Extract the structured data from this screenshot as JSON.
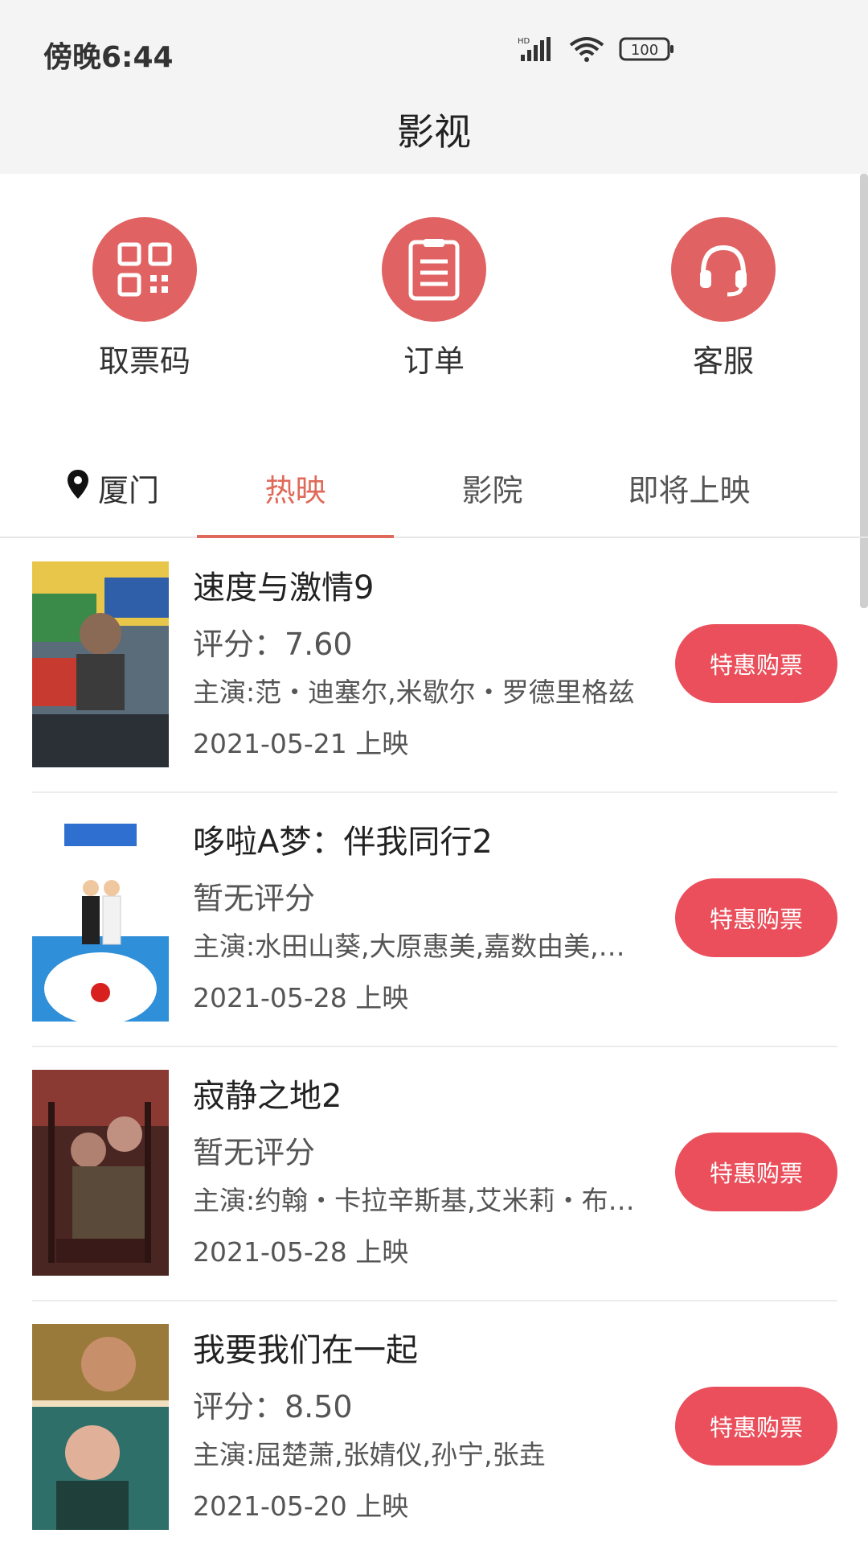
{
  "status_bar": {
    "time": "傍晚6:44",
    "network": "HD",
    "battery": "100"
  },
  "header": {
    "title": "影视"
  },
  "quick_actions": [
    {
      "label": "取票码",
      "icon": "qr-code-icon"
    },
    {
      "label": "订单",
      "icon": "order-list-icon"
    },
    {
      "label": "客服",
      "icon": "headset-icon"
    }
  ],
  "tabs": {
    "location": "厦门",
    "items": [
      "热映",
      "影院",
      "即将上映"
    ],
    "active": "热映"
  },
  "movies": [
    {
      "title": "速度与激情9",
      "rating": "评分：7.60",
      "cast": "主演:范・迪塞尔,米歇尔・罗德里格兹",
      "date": "2021-05-21 上映",
      "button": "特惠购票"
    },
    {
      "title": "哆啦A梦：伴我同行2",
      "rating": "暂无评分",
      "cast": "主演:水田山葵,大原惠美,嘉数由美,关智一",
      "date": "2021-05-28 上映",
      "button": "特惠购票"
    },
    {
      "title": "寂静之地2",
      "rating": "暂无评分",
      "cast": "主演:约翰・卡拉辛斯基,艾米莉・布朗特",
      "date": "2021-05-28 上映",
      "button": "特惠购票"
    },
    {
      "title": "我要我们在一起",
      "rating": "评分：8.50",
      "cast": "主演:屈楚萧,张婧仪,孙宁,张垚",
      "date": "2021-05-20 上映",
      "button": "特惠购票"
    }
  ],
  "colors": {
    "accent": "#e06262",
    "button": "#ea4f5b",
    "active_tab": "#e06a5a"
  }
}
